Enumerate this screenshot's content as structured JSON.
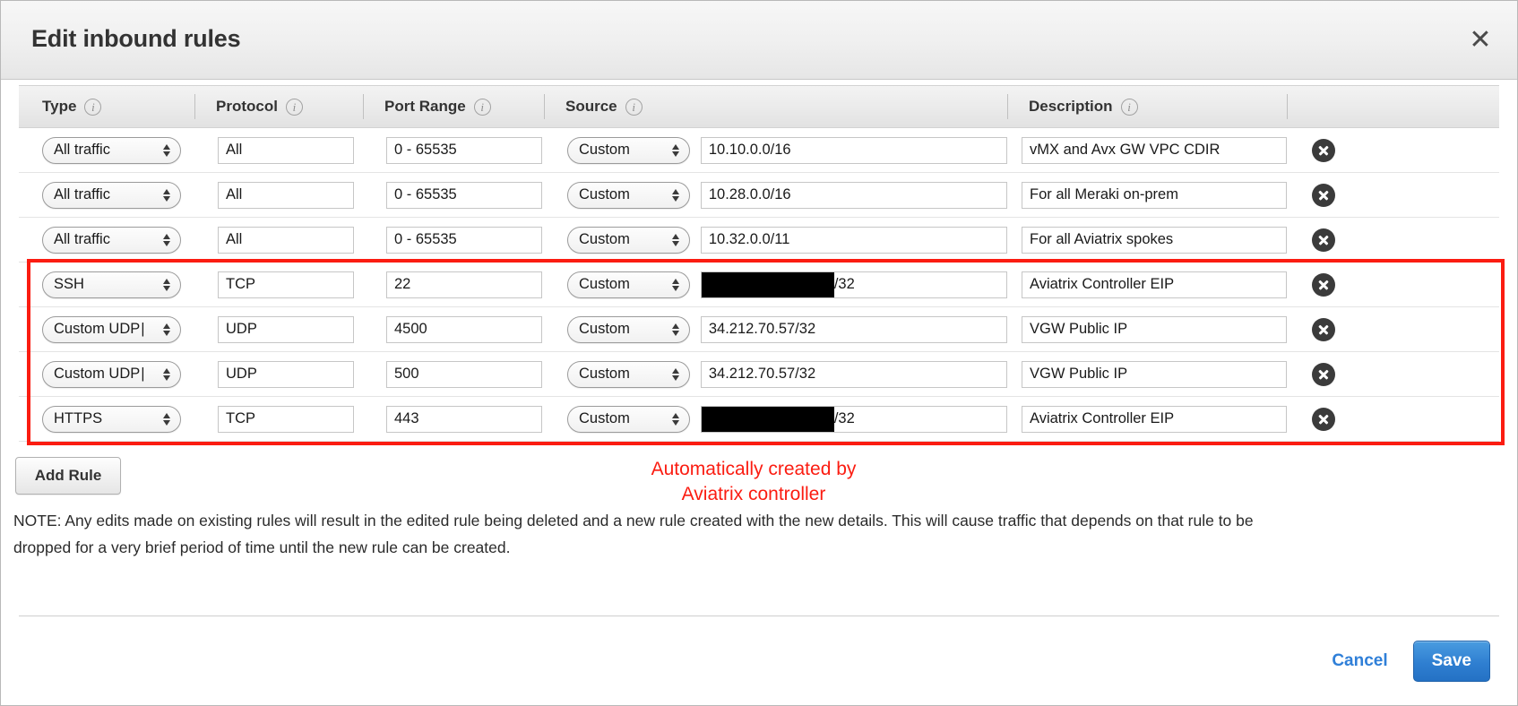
{
  "dialog": {
    "title": "Edit inbound rules",
    "close_icon": "close-icon"
  },
  "table": {
    "headers": [
      {
        "label": "Type",
        "info_icon": "info-icon"
      },
      {
        "label": "Protocol",
        "info_icon": "info-icon"
      },
      {
        "label": "Port Range",
        "info_icon": "info-icon"
      },
      {
        "label": "Source",
        "info_icon": "info-icon"
      },
      {
        "label": "Description",
        "info_icon": "info-icon"
      }
    ],
    "rows": [
      {
        "type": "All traffic",
        "type_truncated": false,
        "protocol": "All",
        "port": "0 - 65535",
        "source_kind": "Custom",
        "source": "10.10.0.0/16",
        "source_redacted": false,
        "description": "vMX and Avx GW VPC CDIR",
        "highlighted": false
      },
      {
        "type": "All traffic",
        "type_truncated": false,
        "protocol": "All",
        "port": "0 - 65535",
        "source_kind": "Custom",
        "source": "10.28.0.0/16",
        "source_redacted": false,
        "description": "For all Meraki on-prem",
        "highlighted": false
      },
      {
        "type": "All traffic",
        "type_truncated": false,
        "protocol": "All",
        "port": "0 - 65535",
        "source_kind": "Custom",
        "source": "10.32.0.0/11",
        "source_redacted": false,
        "description": "For all Aviatrix spokes",
        "highlighted": false
      },
      {
        "type": "SSH",
        "type_truncated": false,
        "protocol": "TCP",
        "port": "22",
        "source_kind": "Custom",
        "source": "/32",
        "source_redacted": true,
        "description": "Aviatrix Controller EIP",
        "highlighted": true
      },
      {
        "type": "Custom UDP",
        "type_truncated": true,
        "protocol": "UDP",
        "port": "4500",
        "source_kind": "Custom",
        "source": "34.212.70.57/32",
        "source_redacted": false,
        "description": "VGW Public IP",
        "highlighted": true
      },
      {
        "type": "Custom UDP",
        "type_truncated": true,
        "protocol": "UDP",
        "port": "500",
        "source_kind": "Custom",
        "source": "34.212.70.57/32",
        "source_redacted": false,
        "description": "VGW Public IP",
        "highlighted": true
      },
      {
        "type": "HTTPS",
        "type_truncated": false,
        "protocol": "TCP",
        "port": "443",
        "source_kind": "Custom",
        "source": "/32",
        "source_redacted": true,
        "description": "Aviatrix Controller EIP",
        "highlighted": true
      }
    ],
    "delete_icon": "delete-circle-icon"
  },
  "annotation": {
    "text": "Automatically created by\nAviatrix controller",
    "color": "#fb1c11"
  },
  "actions": {
    "add_rule_label": "Add Rule",
    "cancel_label": "Cancel",
    "save_label": "Save"
  },
  "note": {
    "text": "NOTE: Any edits made on existing rules will result in the edited rule being deleted and a new rule created with the new details. This will cause traffic that depends on that rule to be dropped for a very brief period of time until the new rule can be created."
  },
  "colors": {
    "highlight": "#fb1c11",
    "save_button": "#2f7fd1",
    "cancel_link": "#2f7fd8"
  }
}
